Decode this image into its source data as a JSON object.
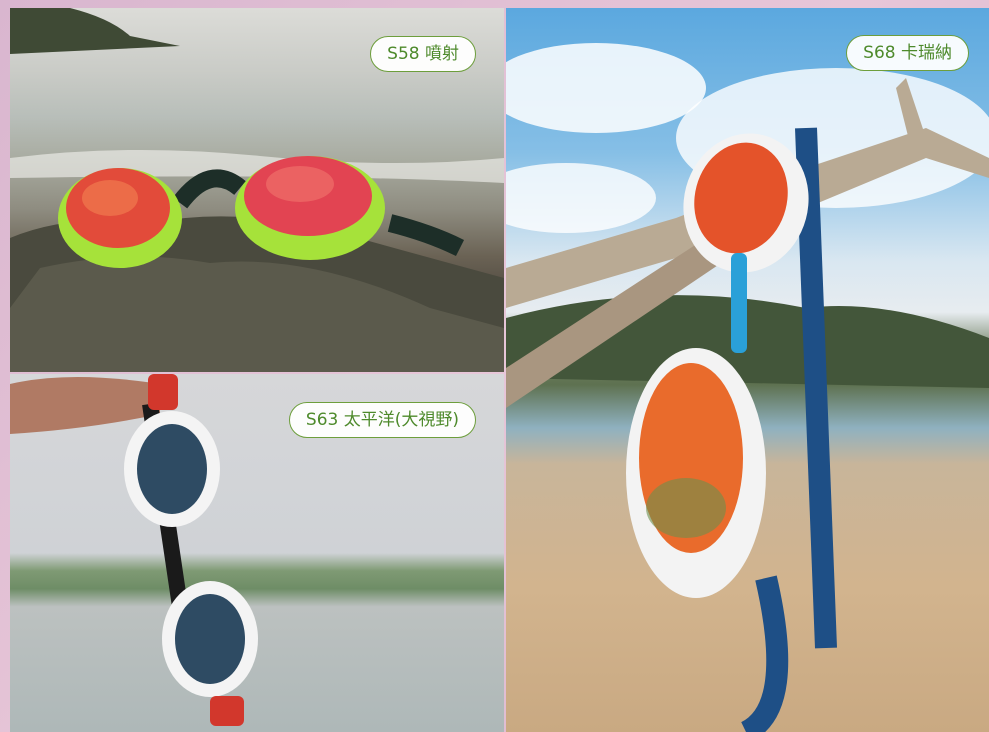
{
  "labels": {
    "s58": "S58 噴射",
    "s63": "S63 太平洋(大視野)",
    "s68": "S68 卡瑞納"
  },
  "colors": {
    "tag_text": "#4e8a2c",
    "tag_border": "#6d9e3c",
    "frame": "#dcb8cf"
  }
}
